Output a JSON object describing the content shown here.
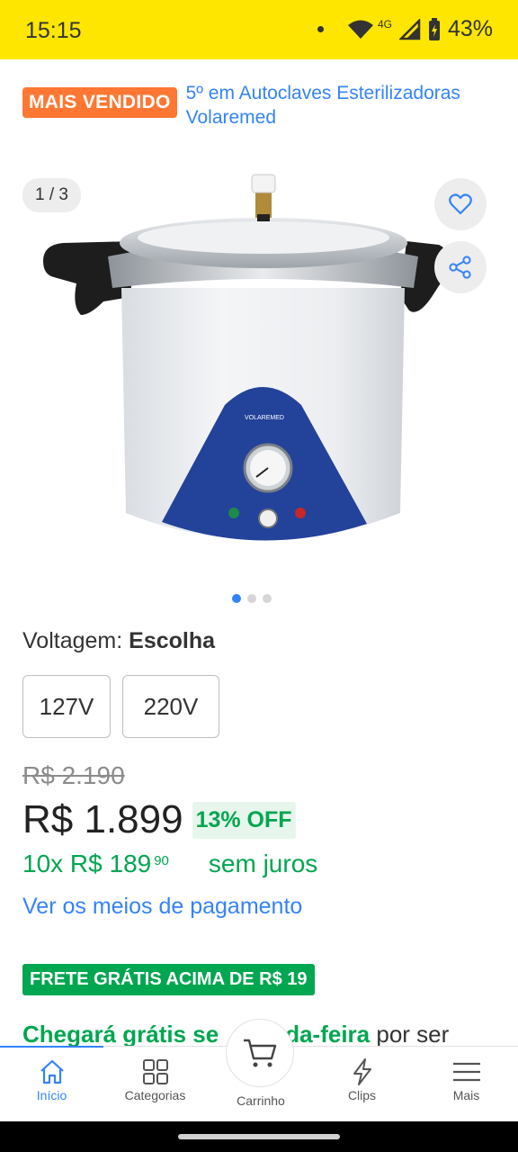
{
  "status_bar": {
    "time": "15:15",
    "network": "4G",
    "battery": "43%"
  },
  "bestseller": {
    "badge": "MAIS VENDIDO",
    "rank_text": "5º em Autoclaves Esterilizadoras Volaremed"
  },
  "gallery": {
    "counter": "1 / 3",
    "brand_on_product": "VOLAREMED",
    "dots_total": 3,
    "dots_active": 1
  },
  "variation": {
    "label": "Voltagem: ",
    "value": "Escolha",
    "options": [
      "127V",
      "220V"
    ]
  },
  "price": {
    "old": "R$ 2.190",
    "current": "R$ 1.899",
    "discount": "13% OFF",
    "installments_main": "10x R$ 189",
    "installments_cents": "90",
    "installments_note": "sem juros",
    "payment_link": "Ver os meios de pagamento"
  },
  "shipping": {
    "badge": "FRETE GRÁTIS ACIMA DE R$ 19",
    "arrival_green": "Chegará grátis se",
    "arrival_green_2": "da-feira",
    "arrival_rest": " por ser"
  },
  "bottom_nav": {
    "items": [
      "Início",
      "Categorias",
      "Carrinho",
      "Clips",
      "Mais"
    ]
  },
  "colors": {
    "status_bar": "#fee600",
    "accent_blue": "#3483fa",
    "green": "#00a650",
    "badge_orange": "#ff7733"
  }
}
